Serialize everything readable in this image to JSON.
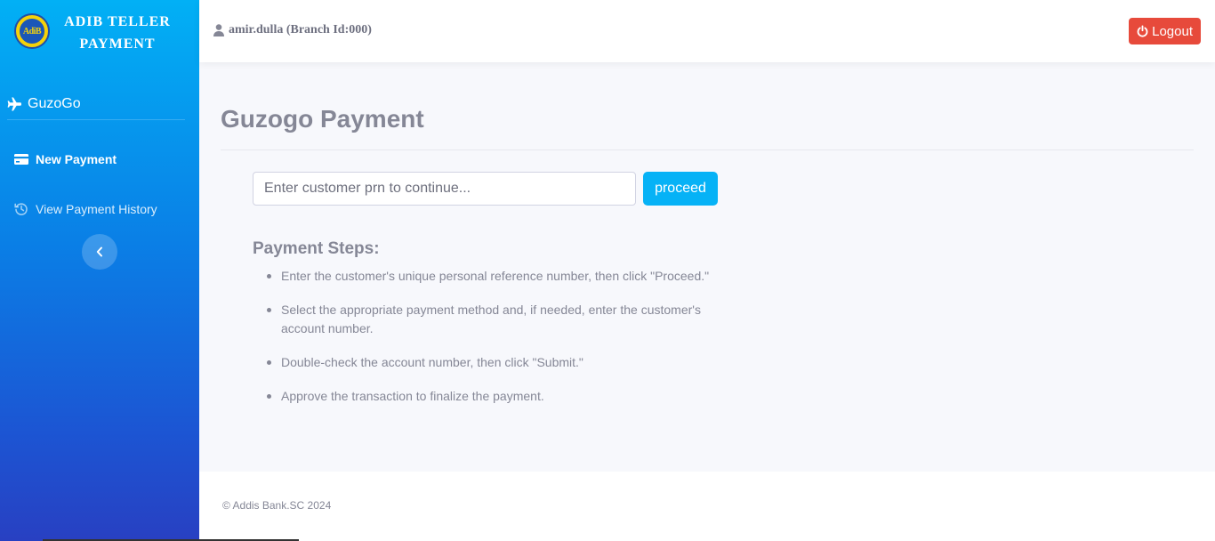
{
  "brand": {
    "logo_text": "AdiB",
    "title_line1": "ADIB TELLER",
    "title_line2": "PAYMENT"
  },
  "sidebar": {
    "section_label": "GuzoGo",
    "section_icon": "plane-icon",
    "items": [
      {
        "label": "New Payment",
        "icon": "credit-card-icon",
        "active": true
      },
      {
        "label": "View Payment History",
        "icon": "history-icon",
        "active": false
      }
    ]
  },
  "topbar": {
    "user": "amir.dulla (Branch Id:000)",
    "logout_label": "Logout"
  },
  "main": {
    "title": "Guzogo Payment",
    "input_placeholder": "Enter customer prn to continue...",
    "input_value": "",
    "proceed_label": "proceed",
    "steps_title": "Payment Steps:",
    "steps": [
      "Enter the customer's unique personal reference number, then click \"Proceed.\"",
      "Select the appropriate payment method and, if needed, enter the customer's account number.",
      "Double-check the account number, then click \"Submit.\"",
      "Approve the transaction to finalize the payment."
    ]
  },
  "footer": {
    "text": "© Addis Bank.SC 2024"
  },
  "colors": {
    "sidebar_top": "#02b0f5",
    "sidebar_bottom": "#2840c2",
    "logout": "#e74a3b",
    "proceed": "#06b2f6",
    "text_muted": "#858796"
  }
}
